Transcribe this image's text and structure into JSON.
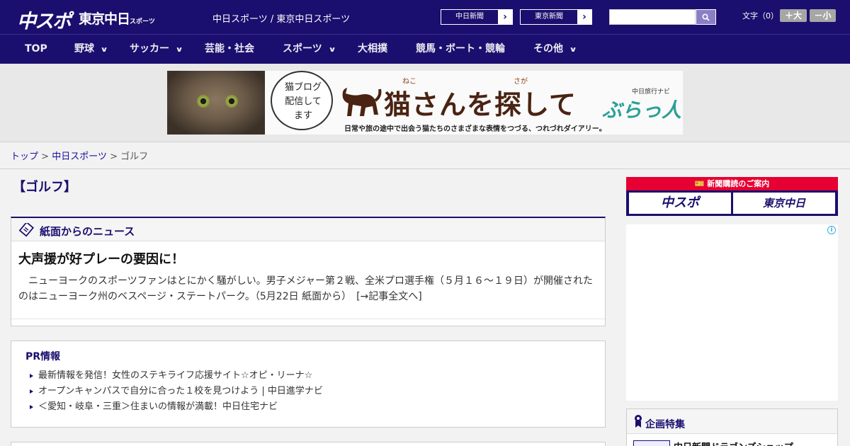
{
  "header": {
    "logo_main": "中スポ",
    "logo_tokyo": "東京中日",
    "logo_tokyo_small": "スポーツ",
    "site_title": "中日スポーツ / 東京中日スポーツ",
    "paper_links": [
      {
        "label": "中日新聞"
      },
      {
        "label": "東京新聞"
      }
    ],
    "search": {
      "placeholder": "",
      "icon": "search-icon"
    },
    "font_size": {
      "label": "文字（0）",
      "plus": "＋大",
      "minus": "－小"
    }
  },
  "nav": {
    "items": [
      {
        "label": "TOP",
        "has_dropdown": false
      },
      {
        "label": "野球",
        "has_dropdown": true
      },
      {
        "label": "サッカー",
        "has_dropdown": true
      },
      {
        "label": "芸能・社会",
        "has_dropdown": false
      },
      {
        "label": "スポーツ",
        "has_dropdown": true
      },
      {
        "label": "大相撲",
        "has_dropdown": false
      },
      {
        "label": "競馬・ボート・競輪",
        "has_dropdown": false
      },
      {
        "label": "その他",
        "has_dropdown": true
      }
    ]
  },
  "banner": {
    "bubble_text": "猫ブログ配信してます",
    "ruby_1": "ねこ",
    "ruby_2": "さが",
    "title": "猫さんを探して",
    "brand_small": "中日旅行ナビ",
    "brand": "ぶらっ人",
    "subtitle": "日常や旅の途中で出会う猫たちのさまざまな表情をつづる、つれづれダイアリー。"
  },
  "breadcrumb": {
    "items": [
      "トップ",
      "中日スポーツ",
      "ゴルフ"
    ],
    "separator": ">"
  },
  "main": {
    "page_heading": "【ゴルフ】",
    "news_section": {
      "label": "紙面からのニュース",
      "article_title": "大声援が好プレーの要因に！",
      "article_body": "ニューヨークのスポーツファンはとにかく騒がしい。男子メジャー第２戦、全米プロ選手権（５月１６～１９日）が開催されたのはニューヨーク州のベスページ・ステートパーク。（5月22日 紙面から）",
      "more_link": "[→記事全文へ]"
    },
    "pr": {
      "title": "PR情報",
      "items": [
        "最新情報を発信！女性のステキライフ応援サイト☆オピ・リーナ☆",
        "オープンキャンパスで自分に合った１校を見つけよう | 中日進学ナビ",
        "＜愛知・岐阜・三重＞住まいの情報が満載！中日住宅ナビ"
      ]
    }
  },
  "sidebar": {
    "subscription": {
      "label": "新聞購読のご案内",
      "logo_1": "中スポ",
      "logo_2": "東京中日"
    },
    "ad_info_icon": "i",
    "feature": {
      "label": "企画特集",
      "item": "中日新聞ドラゴンズショップ"
    }
  },
  "colors": {
    "brand_navy": "#1a0f6e",
    "accent_red": "#e60033",
    "link_blue": "#1a0f9e"
  }
}
